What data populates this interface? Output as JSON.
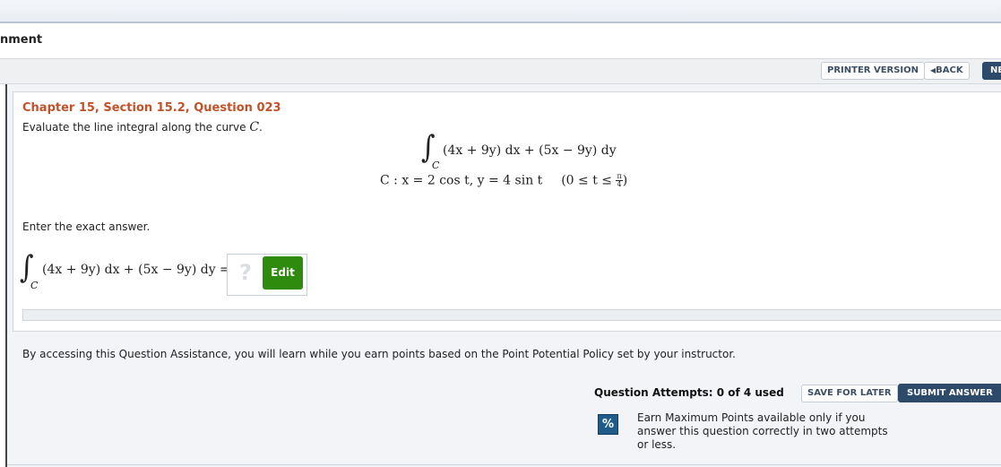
{
  "header": {
    "assignment_title": "nment"
  },
  "toolbar": {
    "printer_version": "PRINTER VERSION",
    "back": "BACK",
    "back_icon": "caret-left-icon",
    "next": "NE"
  },
  "question": {
    "heading": "Chapter 15, Section 15.2, Question 023",
    "prompt_text": "Evaluate the line integral along the curve ",
    "prompt_var": "C",
    "prompt_end": ".",
    "integral_sub": "C",
    "integrand": "(4x + 9y) dx + (5x − 9y) dy",
    "curve_prefix": "C :  x = 2  cos  t,  y = 4  sin  t",
    "interval_left": "(0 ≤ t ≤ ",
    "interval_num": "π",
    "interval_den": "4",
    "interval_right": ")",
    "enter_label": "Enter the exact answer.",
    "answer_lhs": "(4x + 9y) dx + (5x − 9y) dy =",
    "answer_placeholder": "?",
    "edit_label": "Edit"
  },
  "assistance": {
    "note": "By accessing this Question Assistance, you will learn while you earn points based on the Point Potential Policy set by your instructor."
  },
  "footer": {
    "attempts": "Question Attempts: 0 of 4 used",
    "save_for_later": "SAVE FOR LATER",
    "submit_answer": "SUBMIT ANSWER",
    "percent_icon_text": "%",
    "earn_note": "Earn Maximum Points available only if you answer this question correctly in two attempts or less."
  },
  "colors": {
    "heading": "#c0522a",
    "edit_button": "#2e8b0e",
    "primary_button": "#2d4a6b"
  }
}
